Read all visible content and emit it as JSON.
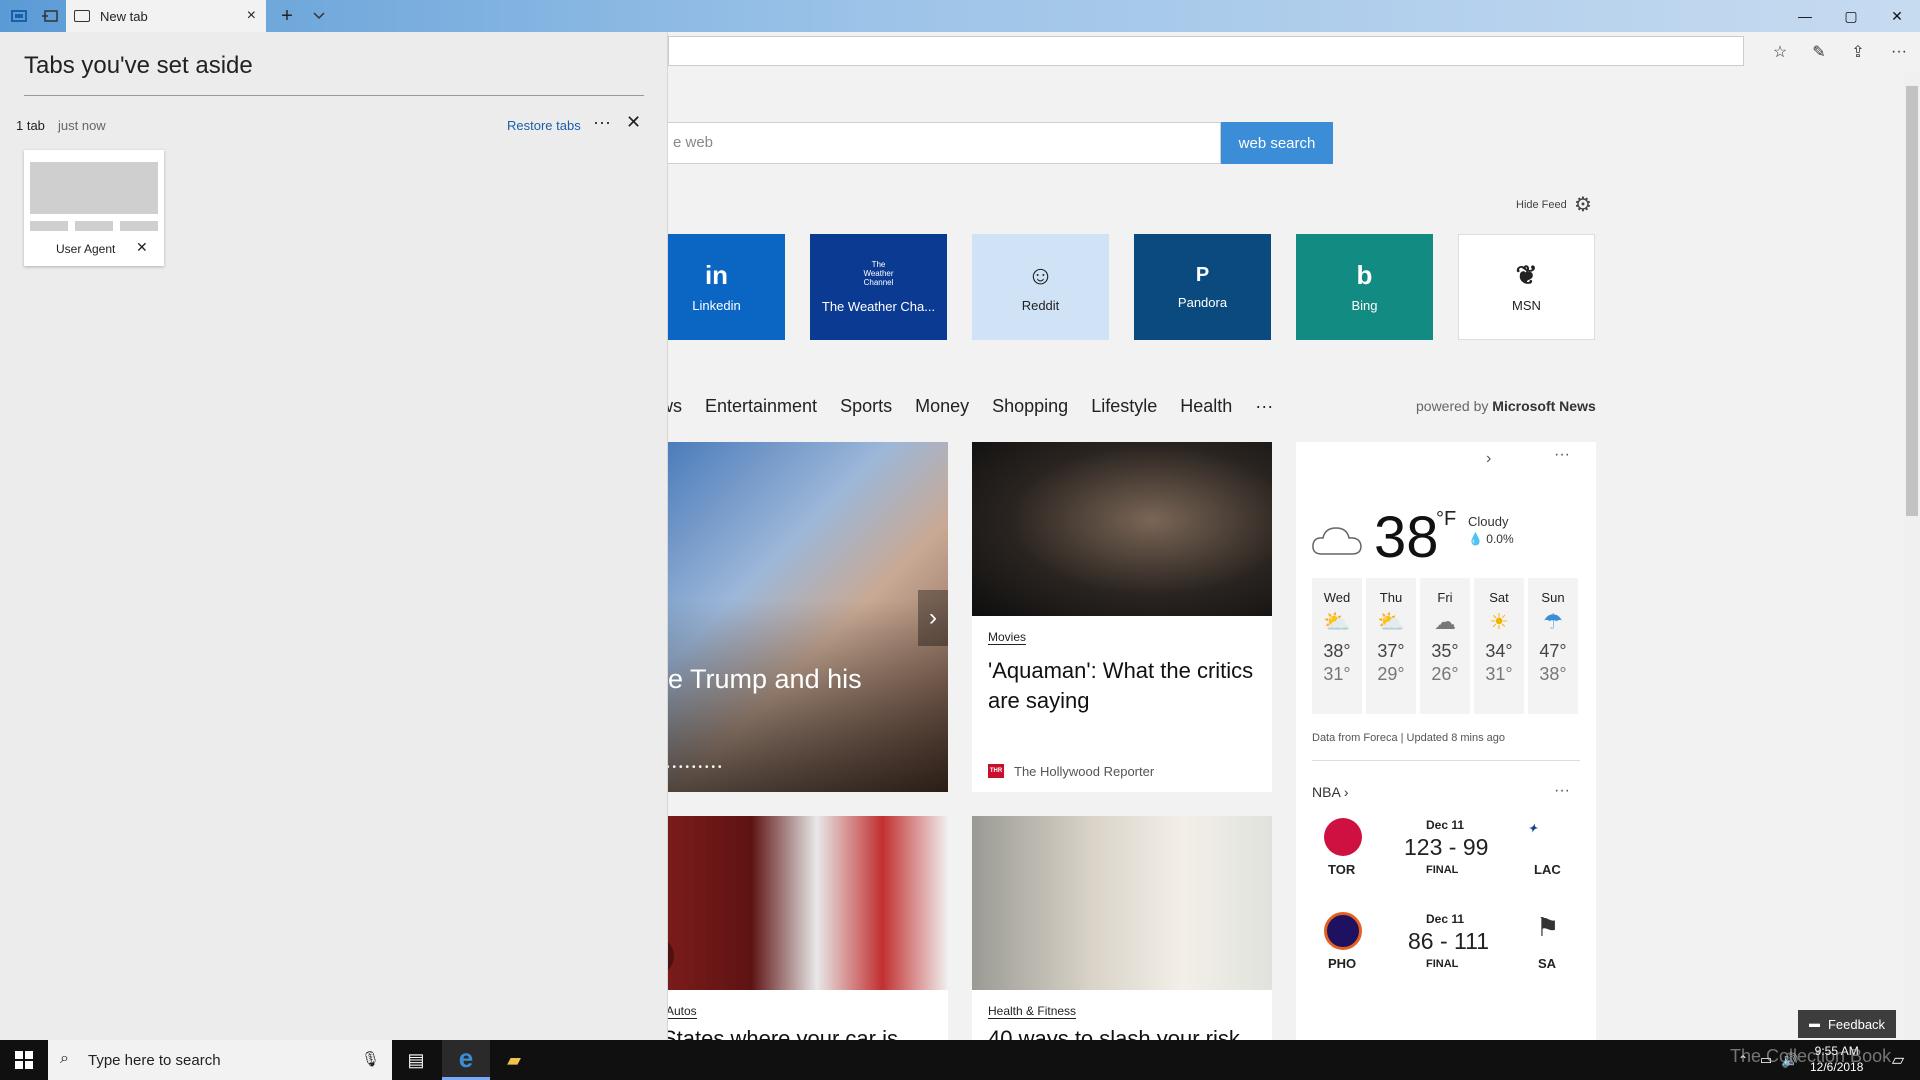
{
  "browser": {
    "tab_title": "New tab",
    "new_tab_symbol": "+",
    "tab_close_symbol": "×",
    "window_controls": {
      "minimize": "—",
      "maximize": "▢",
      "close": "✕"
    },
    "toolbar_more": "···"
  },
  "search": {
    "placeholder_visible": "e web",
    "button_label": "web search"
  },
  "feed_controls": {
    "hide_feed_label": "Hide Feed"
  },
  "tiles": [
    {
      "label": "Linkedin",
      "icon_text": "in",
      "bg": "#0a66c2",
      "icon": "linkedin-icon"
    },
    {
      "label": "The Weather Cha...",
      "icon_text": "The\nWeather\nChannel",
      "bg": "#0b3a93",
      "icon": "weather-channel-icon"
    },
    {
      "label": "Reddit",
      "icon_text": "☺",
      "bg": "#cfe2f6",
      "icon": "reddit-icon"
    },
    {
      "label": "Pandora",
      "icon_text": "P",
      "bg": "#0b4a7e",
      "icon": "pandora-icon"
    },
    {
      "label": "Bing",
      "icon_text": "b",
      "bg": "#128b82",
      "icon": "bing-icon"
    },
    {
      "label": "MSN",
      "icon_text": "❦",
      "bg": "#ffffff",
      "icon": "msn-icon"
    }
  ],
  "categories": [
    "ws",
    "Entertainment",
    "Sports",
    "Money",
    "Shopping",
    "Lifestyle",
    "Health",
    "···"
  ],
  "powered_by": {
    "prefix": "powered by",
    "brand": "Microsoft News"
  },
  "cards": {
    "hero": {
      "headline": "e Trump and his"
    },
    "movies": {
      "tag": "Movies",
      "headline": "'Aquaman': What the critics are saying",
      "source": "The Hollywood Reporter",
      "source_badge": "THR"
    },
    "autos": {
      "tag": "Autos",
      "headline": "States where your car is"
    },
    "health": {
      "tag": "Health & Fitness",
      "headline": "40 ways to slash your risk"
    }
  },
  "weather": {
    "temp": "38",
    "unit": "°F",
    "condition": "Cloudy",
    "precip": "0.0%",
    "forecast": [
      {
        "day": "Wed",
        "hi": "38°",
        "lo": "31°",
        "icon": "partly-sunny-icon"
      },
      {
        "day": "Thu",
        "hi": "37°",
        "lo": "29°",
        "icon": "partly-sunny-icon"
      },
      {
        "day": "Fri",
        "hi": "35°",
        "lo": "26°",
        "icon": "cloudy-icon"
      },
      {
        "day": "Sat",
        "hi": "34°",
        "lo": "31°",
        "icon": "sunny-icon"
      },
      {
        "day": "Sun",
        "hi": "47°",
        "lo": "38°",
        "icon": "rain-icon"
      }
    ],
    "note": "Data from Foreca | Updated 8 mins ago"
  },
  "nba": {
    "title": "NBA",
    "games": [
      {
        "date": "Dec 11",
        "score": "123 - 99",
        "status": "FINAL",
        "home": "TOR",
        "away": "LAC"
      },
      {
        "date": "Dec 11",
        "score": "86 - 111",
        "status": "FINAL",
        "home": "PHO",
        "away": "SA"
      }
    ]
  },
  "aside": {
    "title": "Tabs you've set aside",
    "count": "1 tab",
    "when": "just now",
    "restore_label": "Restore tabs",
    "more": "···",
    "close": "✕",
    "tab_label": "User Agent",
    "tab_close": "✕"
  },
  "feedback": {
    "label": "Feedback"
  },
  "taskbar": {
    "search_placeholder": "Type here to search",
    "time": "9:55 AM",
    "date": "12/6/2018"
  },
  "watermark": "The Collection Book"
}
